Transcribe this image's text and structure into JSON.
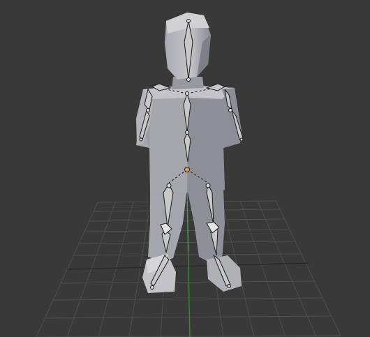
{
  "viewport": {
    "background": "#393939",
    "grid_color": "#4e4e4e",
    "x_axis_color": "#2a2a2a",
    "y_axis_color": "#2e8b2e"
  },
  "character": {
    "mesh_light": "#b8b8be",
    "mesh_mid": "#9c9ca3",
    "mesh_dark": "#7e7e87",
    "bone_fill": "#c8c8cc",
    "bone_outline": "#1a1a1a",
    "active_bone_color": "#e8a060"
  }
}
